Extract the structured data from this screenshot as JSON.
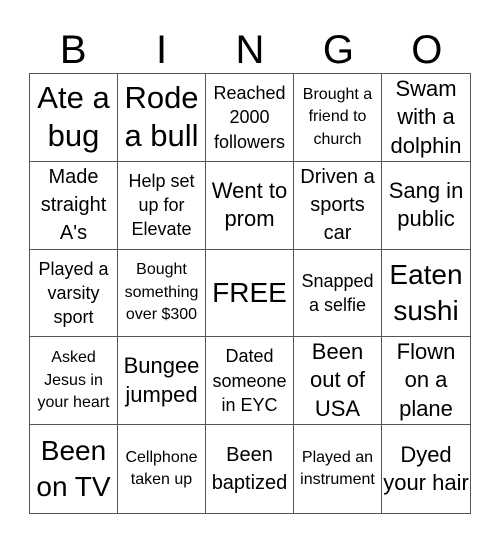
{
  "header": {
    "letters": [
      "B",
      "I",
      "N",
      "G",
      "O"
    ]
  },
  "cells": [
    "Ate a bug",
    "Rode a bull",
    "Reached 2000 followers",
    "Brought a friend to church",
    "Swam with a dolphin",
    "Made straight A's",
    "Help set up for Elevate",
    "Went to prom",
    "Driven a sports car",
    "Sang in public",
    "Played a varsity sport",
    "Bought something over $300",
    "FREE",
    "Snapped a selfie",
    "Eaten sushi",
    "Asked Jesus in your heart",
    "Bungee jumped",
    "Dated someone in EYC",
    "Been out of USA",
    "Flown on a plane",
    "Been on TV",
    "Cellphone taken up",
    "Been baptized",
    "Played an instrument",
    "Dyed your hair"
  ]
}
